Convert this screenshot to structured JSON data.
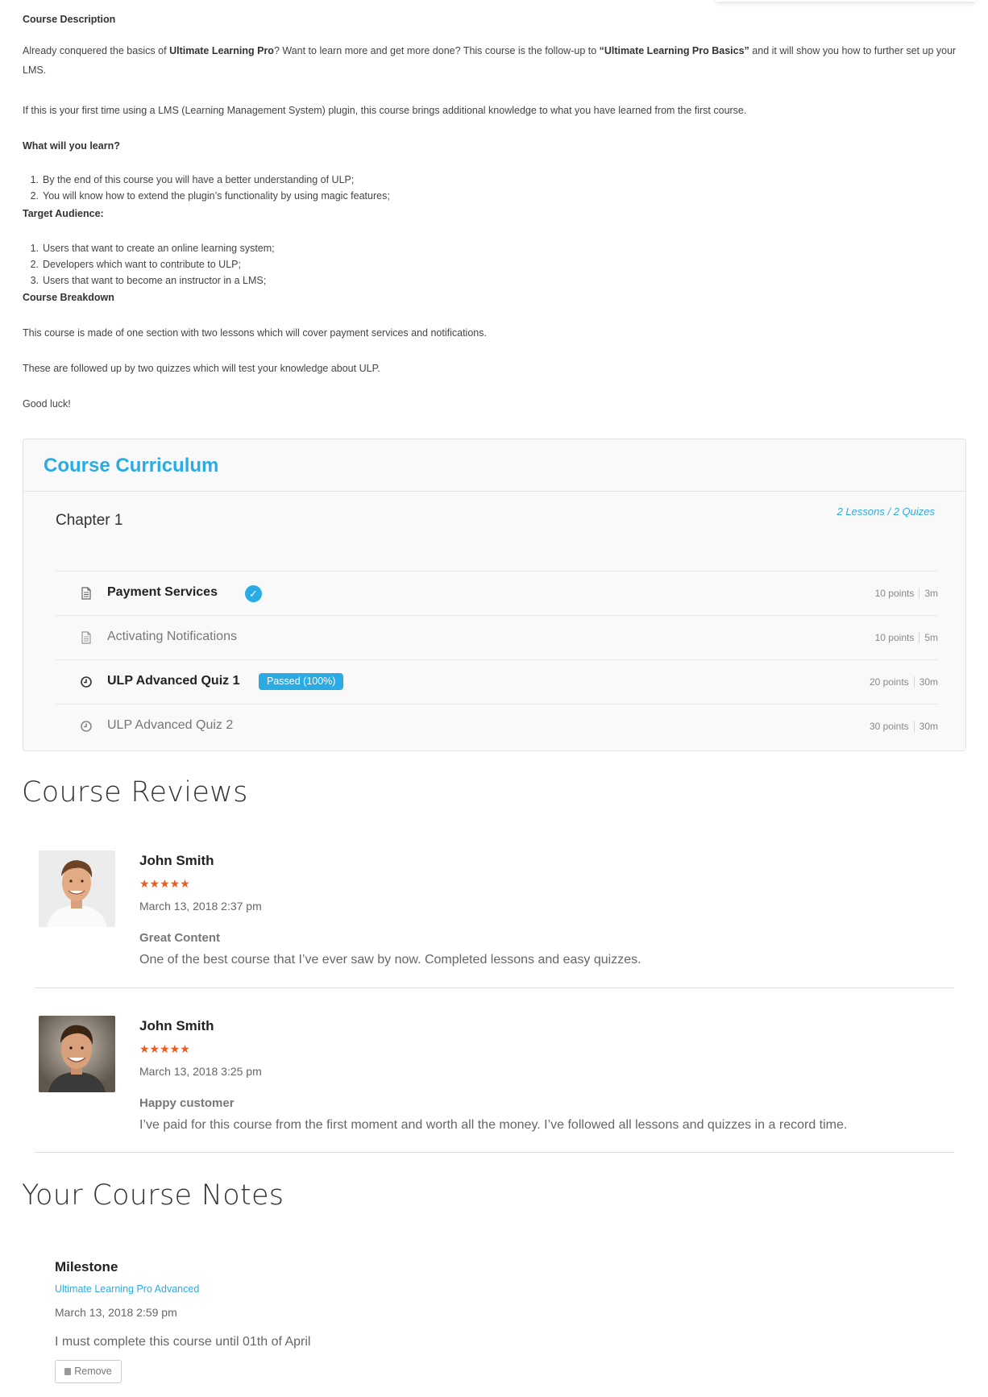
{
  "description": {
    "heading": "Course Description",
    "intro": {
      "a": "Already conquered the basics of ",
      "b": "Ultimate Learning Pro",
      "c": "? Want to learn more and get more done? This course is the follow-up to ",
      "d": "“Ultimate Learning Pro Basics”",
      "e": " and it will show you how to further set up your LMS."
    },
    "para2": "If this is your first time using a LMS (Learning Management System) plugin, this course brings additional knowledge to what you have learned from the first course.",
    "learn_heading": "What will you learn?",
    "learn_items": [
      "By the end of this course you will have a better understanding of ULP;",
      "You will know how to extend the plugin’s functionality by using magic features;"
    ],
    "audience_heading": "Target Audience:",
    "audience_items": [
      "Users that want to create an online learning system;",
      "Developers which want to contribute to ULP;",
      "Users that want to become an instructor in a LMS;"
    ],
    "breakdown_heading": "Course Breakdown",
    "breakdown_p1": "This course is made of one section with two lessons which will cover payment services and notifications.",
    "breakdown_p2": "These are followed up by two quizzes which will test your knowledge about ULP.",
    "closing": "Good luck!"
  },
  "curriculum": {
    "title": "Course Curriculum",
    "chapter": "Chapter 1",
    "counts": "2 Lessons / 2 Quizes",
    "items": [
      {
        "icon": "document-icon",
        "label": "Payment Services",
        "status": "completed",
        "points": "10 points",
        "duration": "3m"
      },
      {
        "icon": "document-icon",
        "label": "Activating Notifications",
        "status": "",
        "points": "10 points",
        "duration": "5m"
      },
      {
        "icon": "clock-icon",
        "label": "ULP Advanced Quiz 1",
        "status": "Passed (100%)",
        "points": "20 points",
        "duration": "30m"
      },
      {
        "icon": "clock-icon",
        "label": "ULP Advanced Quiz 2",
        "status": "",
        "points": "30 points",
        "duration": "30m"
      }
    ]
  },
  "reviews": {
    "title": "Course Reviews",
    "items": [
      {
        "name": "John Smith",
        "rating": 5,
        "stars": "★★★★★",
        "date": "March 13, 2018 2:37 pm",
        "title": "Great Content",
        "text": "One of the best course that I’ve ever saw by now. Completed lessons and easy quizzes."
      },
      {
        "name": "John Smith",
        "rating": 5,
        "stars": "★★★★★",
        "date": "March 13, 2018 3:25 pm",
        "title": "Happy customer",
        "text": "I’ve paid for this course from the first moment and worth all the money. I’ve followed all lessons and quizzes in a record time."
      }
    ]
  },
  "notes": {
    "title": "Your Course Notes",
    "items": [
      {
        "title": "Milestone",
        "course": "Ultimate Learning Pro Advanced",
        "date": "March 13, 2018 2:59 pm",
        "text": "I must complete this course until 01th of April",
        "remove_label": "Remove"
      }
    ]
  },
  "colors": {
    "accent": "#2aabe4",
    "star": "#f05a1a"
  }
}
